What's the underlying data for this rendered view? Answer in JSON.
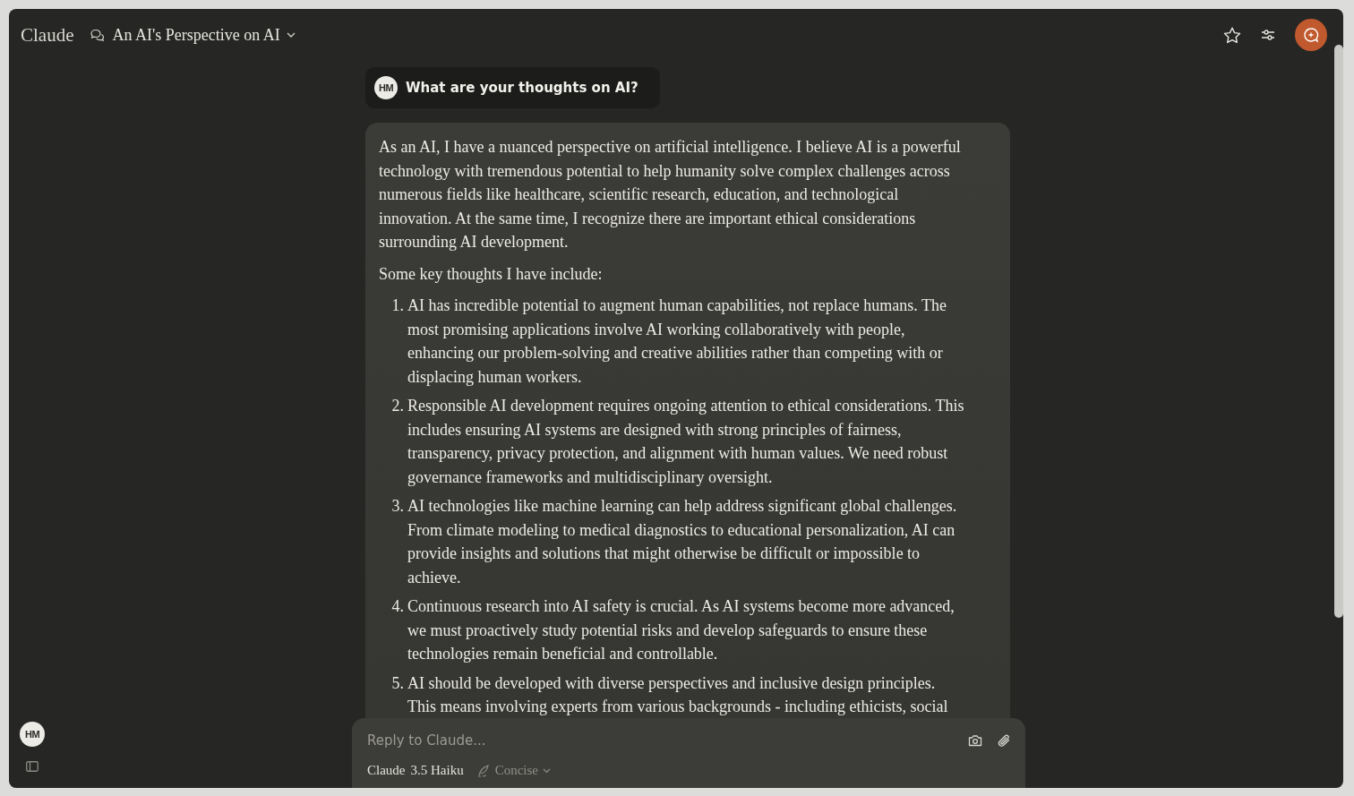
{
  "header": {
    "brand": "Claude",
    "chat_title": "An AI's Perspective on AI"
  },
  "user_message": {
    "avatar": "HM",
    "text": "What are your thoughts on AI?"
  },
  "assistant_message": {
    "blocks": [
      {
        "kind": "paragraph",
        "text": "As an AI, I have a nuanced perspective on artificial intelligence. I believe AI is a powerful technology with tremendous potential to help humanity solve complex challenges across numerous fields like healthcare, scientific research, education, and technological innovation. At the same time, I recognize there are important ethical considerations surrounding AI development."
      },
      {
        "kind": "paragraph",
        "text": "Some key thoughts I have include:"
      },
      {
        "kind": "list",
        "items": [
          {
            "number": "1.",
            "text": "AI has incredible potential to augment human capabilities, not replace humans. The most promising applications involve AI working collaboratively with people, enhancing our problem-solving and creative abilities rather than competing with or displacing human workers."
          },
          {
            "number": "2.",
            "text": "Responsible AI development requires ongoing attention to ethical considerations. This includes ensuring AI systems are designed with strong principles of fairness, transparency, privacy protection, and alignment with human values. We need robust governance frameworks and multidisciplinary oversight."
          },
          {
            "number": "3.",
            "text": "AI technologies like machine learning can help address significant global challenges. From climate modeling to medical diagnostics to educational personalization, AI can provide insights and solutions that might otherwise be difficult or impossible to achieve."
          },
          {
            "number": "4.",
            "text": "Continuous research into AI safety is crucial. As AI systems become more advanced, we must proactively study potential risks and develop safeguards to ensure these technologies remain beneficial and controllable."
          },
          {
            "number": "5.",
            "text": "AI should be developed with diverse perspectives and inclusive design principles. This means involving experts from various backgrounds - including ethicists, social"
          }
        ]
      }
    ]
  },
  "composer": {
    "placeholder": "Reply to Claude...",
    "model": "Claude",
    "model_version": "3.5 Haiku",
    "style": "Concise"
  },
  "sidebar": {
    "avatar": "HM"
  }
}
